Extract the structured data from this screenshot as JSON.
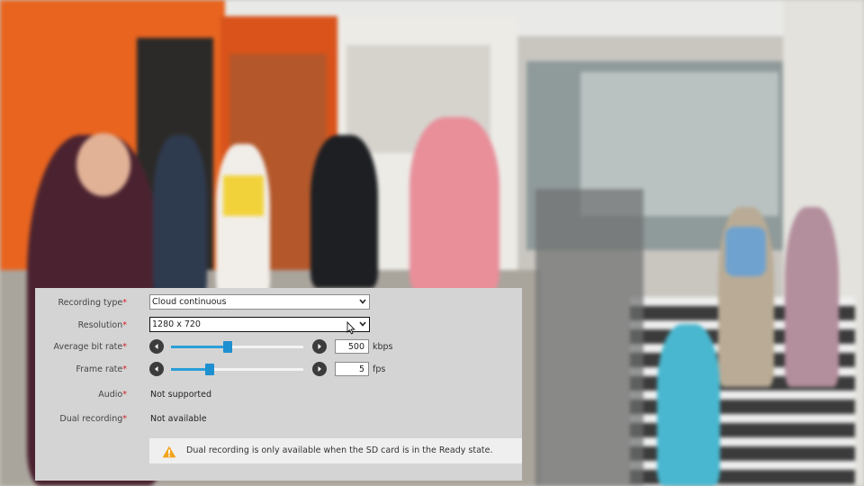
{
  "form": {
    "recording_type": {
      "label": "Recording type",
      "required_mark": "*",
      "value": "Cloud continuous"
    },
    "resolution": {
      "label": "Resolution",
      "required_mark": "*",
      "value": "1280 x 720"
    },
    "bit_rate": {
      "label": "Average bit rate",
      "required_mark": "*",
      "value": "500",
      "unit": "kbps",
      "slider_level": 0.43
    },
    "frame_rate": {
      "label": "Frame rate",
      "required_mark": "*",
      "value": "5",
      "unit": "fps",
      "slider_level": 0.29
    },
    "audio": {
      "label": "Audio",
      "required_mark": "*",
      "value": "Not supported"
    },
    "dual_recording": {
      "label": "Dual recording",
      "required_mark": "*",
      "value": "Not available"
    }
  },
  "notice": {
    "text": "Dual recording is only available when the SD card is in the Ready state.",
    "icon": "warning-icon",
    "icon_color": "#f2a31b"
  },
  "colors": {
    "accent": "#1e8fcf",
    "required": "#d9232b",
    "panel_bg": "#d4d4d4"
  }
}
